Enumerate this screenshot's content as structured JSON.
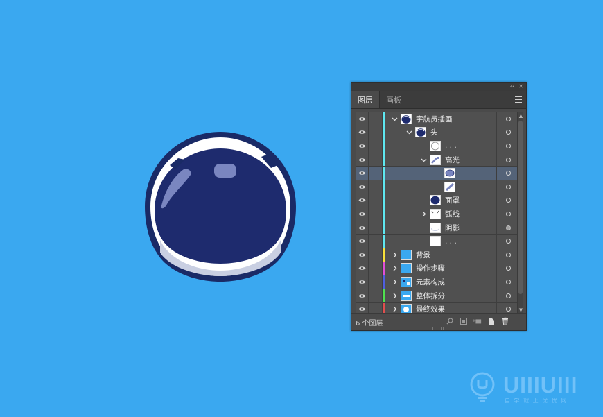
{
  "panel": {
    "top_controls": [
      "‹‹",
      "✕"
    ],
    "tabs": [
      {
        "label": "图层",
        "active": true
      },
      {
        "label": "画板",
        "active": false
      }
    ],
    "layers": [
      {
        "name": "宇航员插画",
        "level": 0,
        "expanded": true,
        "has_chevron": true,
        "color": "#5ee7f0",
        "thumb": "helmet",
        "selected": false,
        "target_filled": false
      },
      {
        "name": "头",
        "level": 1,
        "expanded": true,
        "has_chevron": true,
        "color": "#5ee7f0",
        "thumb": "helmet",
        "selected": false,
        "target_filled": false
      },
      {
        "name": ". . .",
        "level": 2,
        "expanded": false,
        "has_chevron": false,
        "color": "#5ee7f0",
        "thumb": "circle",
        "selected": false,
        "target_filled": false
      },
      {
        "name": "高光",
        "level": 2,
        "expanded": true,
        "has_chevron": true,
        "color": "#5ee7f0",
        "thumb": "highlight",
        "selected": false,
        "target_filled": false
      },
      {
        "name": "",
        "level": 3,
        "expanded": false,
        "has_chevron": false,
        "color": "#5ee7f0",
        "thumb": "oval",
        "selected": true,
        "target_filled": false
      },
      {
        "name": "",
        "level": 3,
        "expanded": false,
        "has_chevron": false,
        "color": "#5ee7f0",
        "thumb": "stroke",
        "selected": false,
        "target_filled": false
      },
      {
        "name": "面罩",
        "level": 2,
        "expanded": false,
        "has_chevron": false,
        "color": "#5ee7f0",
        "thumb": "mask",
        "selected": false,
        "target_filled": false
      },
      {
        "name": "弧线",
        "level": 2,
        "expanded": false,
        "has_chevron": true,
        "color": "#5ee7f0",
        "thumb": "arcs",
        "selected": false,
        "target_filled": false
      },
      {
        "name": "阴影",
        "level": 2,
        "expanded": false,
        "has_chevron": false,
        "color": "#5ee7f0",
        "thumb": "shadow",
        "selected": false,
        "target_filled": true
      },
      {
        "name": ". . .",
        "level": 2,
        "expanded": false,
        "has_chevron": false,
        "color": "#5ee7f0",
        "thumb": "blank",
        "selected": false,
        "target_filled": false
      },
      {
        "name": "背景",
        "level": 0,
        "expanded": false,
        "has_chevron": true,
        "color": "#f7e03a",
        "thumb": "blue",
        "selected": false,
        "target_filled": false
      },
      {
        "name": "操作步骤",
        "level": 0,
        "expanded": false,
        "has_chevron": true,
        "color": "#e04fd6",
        "thumb": "blue",
        "selected": false,
        "target_filled": false
      },
      {
        "name": "元素构成",
        "level": 0,
        "expanded": false,
        "has_chevron": true,
        "color": "#4f5fe0",
        "thumb": "blue-elements",
        "selected": false,
        "target_filled": false
      },
      {
        "name": "整体拆分",
        "level": 0,
        "expanded": false,
        "has_chevron": true,
        "color": "#4fe04f",
        "thumb": "blue-split",
        "selected": false,
        "target_filled": false
      },
      {
        "name": "最终效果",
        "level": 0,
        "expanded": false,
        "has_chevron": true,
        "color": "#e04f4f",
        "thumb": "blue-final",
        "selected": false,
        "target_filled": false
      }
    ],
    "footer": {
      "count_label": "6 个图层",
      "icons": [
        "locate-object-icon",
        "make-clipping-mask-icon",
        "new-sublayer-icon",
        "new-layer-icon",
        "delete-layer-icon"
      ]
    }
  },
  "watermark": {
    "brand": "UIIIUIII",
    "tagline": "自 学 就 上 优 优 网"
  },
  "colors": {
    "background": "#3aa8f0",
    "helmet_fill": "#1e2b6e",
    "helmet_outline": "#1a2a66",
    "panel_bg": "#4a4a4a",
    "selected_row": "#546378"
  }
}
